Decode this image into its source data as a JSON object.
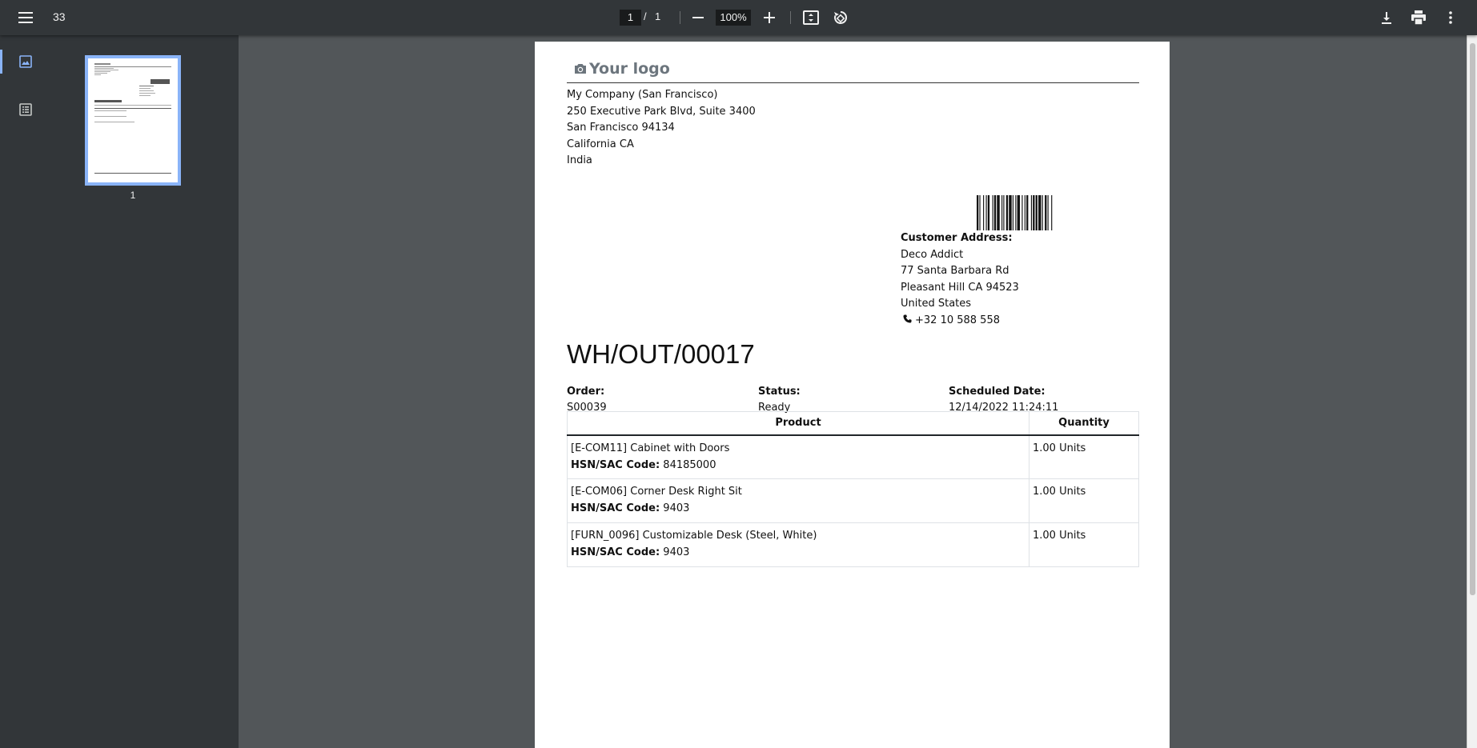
{
  "toolbar": {
    "title": "33",
    "current_page": "1",
    "page_separator": "/",
    "total_pages": "1",
    "zoom": "100%"
  },
  "sidebar": {
    "thumbnail_label": "1"
  },
  "document": {
    "logo_text": "Your logo",
    "company_lines": [
      "My Company (San Francisco)",
      "250 Executive Park Blvd, Suite 3400",
      "San Francisco 94134",
      "California CA",
      "India"
    ],
    "customer": {
      "label": "Customer Address:",
      "name": "Deco Addict",
      "street": "77 Santa Barbara Rd",
      "city": "Pleasant Hill CA 94523",
      "country": "United States",
      "phone": "+32 10 588 558"
    },
    "title": "WH/OUT/00017",
    "order_label": "Order:",
    "order_value": "S00039",
    "status_label": "Status:",
    "status_value": "Ready",
    "scheduled_label": "Scheduled Date:",
    "scheduled_value": "12/14/2022 11:24:11",
    "table": {
      "headers": [
        "Product",
        "Quantity"
      ],
      "hsn_label": "HSN/SAC Code:",
      "rows": [
        {
          "product": "[E-COM11] Cabinet with Doors",
          "hsn": "84185000",
          "qty": "1.00 Units"
        },
        {
          "product": "[E-COM06] Corner Desk Right Sit",
          "hsn": "9403",
          "qty": "1.00 Units"
        },
        {
          "product": "[FURN_0096] Customizable Desk (Steel, White)",
          "hsn": "9403",
          "qty": "1.00 Units"
        }
      ]
    }
  },
  "colors": {
    "toolbar_bg": "#323639",
    "viewer_bg": "#525659",
    "accent": "#8ab4f8"
  }
}
